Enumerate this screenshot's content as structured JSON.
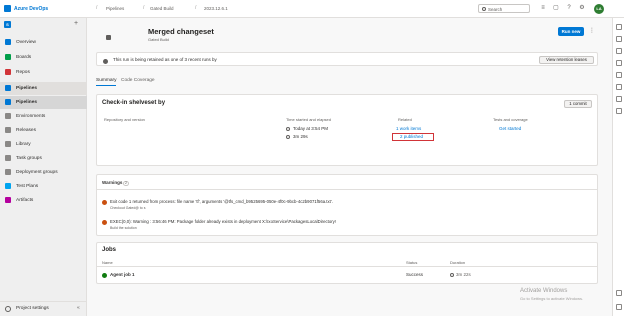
{
  "app": {
    "brand": "Azure DevOps",
    "project_initial": "S"
  },
  "breadcrumbs": [
    "Pipelines",
    "Gated Build",
    "2023.12.6.1"
  ],
  "search": {
    "placeholder": "Search"
  },
  "user": {
    "initials": "LA"
  },
  "sidebar": {
    "items": [
      {
        "label": "Overview",
        "icon": "overview-icon",
        "color": "#0078d4"
      },
      {
        "label": "Boards",
        "icon": "boards-icon",
        "color": "#009e49"
      },
      {
        "label": "Repos",
        "icon": "repos-icon",
        "color": "#d13438"
      },
      {
        "label": "Pipelines",
        "icon": "pipelines-icon",
        "color": "#0078d4"
      },
      {
        "label": "Pipelines",
        "icon": "pipelines-sub-icon",
        "color": "#0078d4"
      },
      {
        "label": "Environments",
        "icon": "environments-icon",
        "color": "#605e5c"
      },
      {
        "label": "Releases",
        "icon": "releases-icon",
        "color": "#605e5c"
      },
      {
        "label": "Library",
        "icon": "library-icon",
        "color": "#605e5c"
      },
      {
        "label": "Task groups",
        "icon": "task-groups-icon",
        "color": "#605e5c"
      },
      {
        "label": "Deployment groups",
        "icon": "deployment-groups-icon",
        "color": "#605e5c"
      },
      {
        "label": "Test Plans",
        "icon": "test-plans-icon",
        "color": "#00a4ef"
      },
      {
        "label": "Artifacts",
        "icon": "artifacts-icon",
        "color": "#b4009e"
      }
    ],
    "settings_label": "Project settings"
  },
  "run": {
    "title": "Merged changeset",
    "pipeline": "Gated Build",
    "run_new_label": "Run new"
  },
  "retention": {
    "text": "This run is being retained as one of 3 recent runs by",
    "button": "View retention leases"
  },
  "tabs": [
    "Summary",
    "Code Coverage"
  ],
  "checkin": {
    "title": "Check-in shelveset by",
    "commit_button": "1 commit",
    "col_repo": "Repository and version",
    "col_time": "Time started and elapsed",
    "col_related": "Related",
    "col_tests": "Tests and coverage",
    "started": "Today at 3:54 PM",
    "elapsed": "3m 29s",
    "work_items": "1 work items",
    "published": "2 published",
    "tests_link": "Get started"
  },
  "warnings": {
    "tab_label": "Warnings",
    "count": "2",
    "items": [
      {
        "message": "Exit code 1 returned from process: file name 'tf', arguments '@tfs_cmd_b9525695-050e-4f0c-9bcb-4c2b9071f56a.txt'.",
        "sub": "Checkout Gated@ to s"
      },
      {
        "message": "EXEC(0,0): Warning : 3:56:46 PM: Package folder already exists in deployment X:\\IxoService\\PackagesLocalDirectory!",
        "sub": "Build the solution"
      }
    ]
  },
  "jobs": {
    "title": "Jobs",
    "col_name": "Name",
    "col_status": "Status",
    "col_duration": "Duration",
    "rows": [
      {
        "name": "Agent job 1",
        "status": "Success",
        "duration": "3m 22s"
      }
    ]
  },
  "watermark": {
    "title": "Activate Windows",
    "sub": "Go to Settings to activate Windows."
  }
}
